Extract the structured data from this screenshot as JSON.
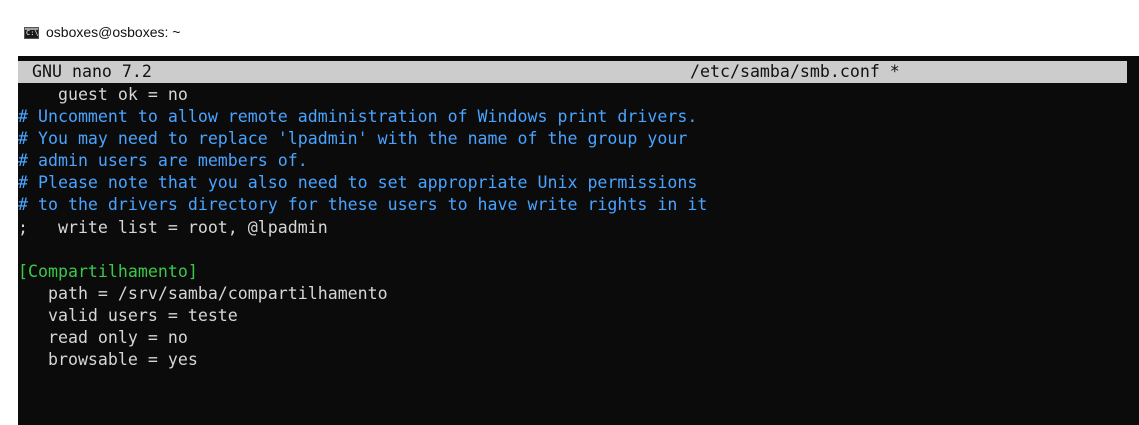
{
  "window": {
    "title": "osboxes@osboxes: ~",
    "icon": "cmd-icon",
    "icon_text": "C:\\."
  },
  "nano": {
    "version_label": "GNU nano 7.2",
    "file_label": "/etc/samba/smb.conf *"
  },
  "lines": [
    {
      "text": "    guest ok = no",
      "kind": "text"
    },
    {
      "text": "# Uncomment to allow remote administration of Windows print drivers.",
      "kind": "comment"
    },
    {
      "text": "# You may need to replace 'lpadmin' with the name of the group your",
      "kind": "comment"
    },
    {
      "text": "# admin users are members of.",
      "kind": "comment"
    },
    {
      "text": "# Please note that you also need to set appropriate Unix permissions",
      "kind": "comment"
    },
    {
      "text": "# to the drivers directory for these users to have write rights in it",
      "kind": "comment"
    },
    {
      "text": ";   write list = root, @lpadmin",
      "kind": "text"
    },
    {
      "text": "",
      "kind": "text"
    },
    {
      "text": "[Compartilhamento]",
      "kind": "section"
    },
    {
      "text": "   path = /srv/samba/compartilhamento",
      "kind": "text"
    },
    {
      "text": "   valid users = teste",
      "kind": "text"
    },
    {
      "text": "   read only = no",
      "kind": "text"
    },
    {
      "text": "   browsable = yes",
      "kind": "text"
    }
  ],
  "colors": {
    "terminal_bg": "#0b0b0b",
    "text": "#d6d6d6",
    "comment": "#49a3ff",
    "section": "#39c94a",
    "header_bg": "#cccccc"
  }
}
